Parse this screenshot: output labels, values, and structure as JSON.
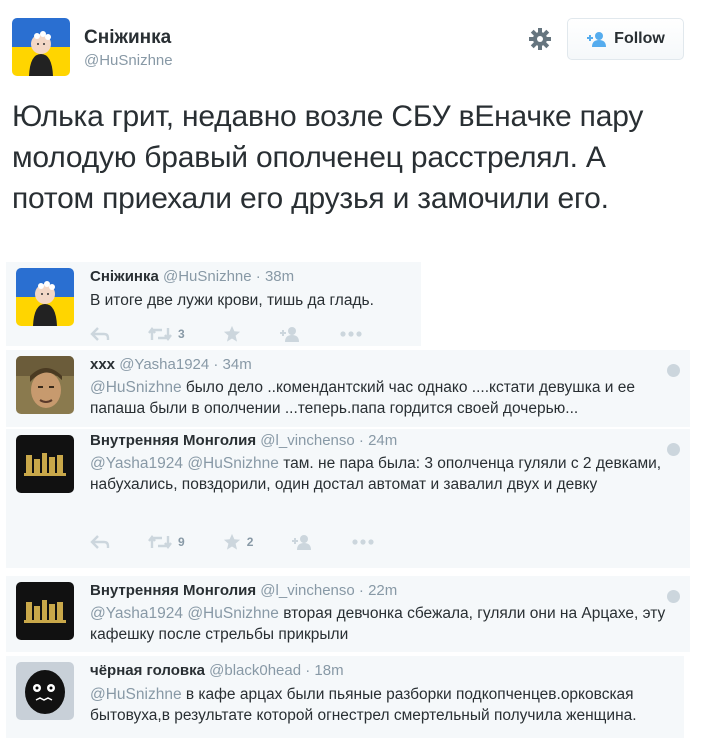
{
  "main": {
    "name": "Сніжинка",
    "handle": "@HuSnizhne",
    "follow_label": "Follow",
    "text": "Юлька грит, недавно возле СБУ вЕначке пару молодую бравый ополченец расстрелял. А потом приехали его друзья и замочили его."
  },
  "replies": [
    {
      "name": "Сніжинка",
      "handle": "@HuSnizhne",
      "time": "· 38m",
      "mentions": "",
      "text": "В итоге две лужи крови, тишь да гладь.",
      "retweets": "3",
      "favorites": ""
    },
    {
      "name": "xxx",
      "handle": "@Yasha1924",
      "time": "· 34m",
      "mentions": "@HuSnizhne",
      "text": " было дело ..комендантский час однако ....кстати девушка и ее папаша были в ополчении ...теперь.папа гордится своей дочерью..."
    },
    {
      "name": "Внутренняя Монголия",
      "handle": "@l_vinchenso",
      "time": "· 24m",
      "mentions": "@Yasha1924 @HuSnizhne",
      "text": " там. не пара была: 3 ополченца гуляли с 2 девками, набухались, повздорили, один достал автомат и завалил двух и девку",
      "retweets": "9",
      "favorites": "2"
    },
    {
      "name": "Внутренняя Монголия",
      "handle": "@l_vinchenso",
      "time": "· 22m",
      "mentions": "@Yasha1924 @HuSnizhne",
      "text": " вторая девчонка сбежала, гуляли они на Арцахе, эту кафешку после стрельбы прикрыли"
    },
    {
      "name": "чёрная головка",
      "handle": "@black0head",
      "time": "· 18m",
      "mentions": "@HuSnizhne",
      "text": " в кафе арцах были пьяные разборки подкопченцев.орковская бытовуха,в результате которой огнестрел смертельный получила женщина."
    }
  ],
  "icons": {
    "gear": "gear-icon",
    "follow": "add-user-icon",
    "reply": "reply-icon",
    "retweet": "retweet-icon",
    "favorite": "star-icon",
    "follow_small": "add-user-icon",
    "more": "more-icon",
    "globe": "globe-icon"
  },
  "colors": {
    "text": "#292f33",
    "muted": "#8899a6",
    "reply_bg": "#f5f8fa",
    "action": "#ccd6dd"
  }
}
